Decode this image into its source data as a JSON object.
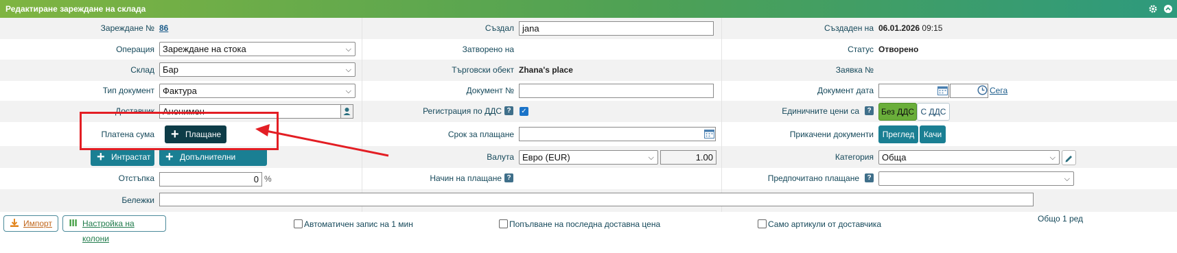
{
  "window": {
    "title": "Редактиране зареждане на склада",
    "icons": [
      "gear-icon",
      "collapse-icon"
    ]
  },
  "fields": {
    "load_no": {
      "label": "Зареждане №",
      "value": "86"
    },
    "created_by": {
      "label": "Създал",
      "value": "jana"
    },
    "created_on": {
      "label": "Създаден на",
      "date": "06.01.2026",
      "time": "09:15"
    },
    "operation": {
      "label": "Операция",
      "value": "Зареждане на стока"
    },
    "closed_on": {
      "label": "Затворено на",
      "value": ""
    },
    "status": {
      "label": "Статус",
      "value": "Отворено"
    },
    "warehouse": {
      "label": "Склад",
      "value": "Бар"
    },
    "outlet": {
      "label": "Търговски обект",
      "value": "Zhana's place"
    },
    "request_no": {
      "label": "Заявка №",
      "value": ""
    },
    "doc_type": {
      "label": "Тип документ",
      "value": "Фактура"
    },
    "doc_no": {
      "label": "Документ №",
      "value": ""
    },
    "doc_date": {
      "label": "Документ дата",
      "value": "",
      "now_link": "Сега"
    },
    "supplier": {
      "label": "Доставчик",
      "value": "Анонимен"
    },
    "vat_reg": {
      "label": "Регистрация по ДДС",
      "help": "?",
      "checked": true
    },
    "unit_prices": {
      "label": "Единичните цени са",
      "option_without_vat": "Без ДДС",
      "option_with_vat": "С ДДС",
      "selected": "Без ДДС"
    },
    "paid_sum": {
      "label": "Платена сума",
      "button": "Плащане"
    },
    "due_date": {
      "label": "Срок за плащане",
      "value": ""
    },
    "attachments": {
      "label": "Прикачени документи",
      "view": "Преглед",
      "upload": "Качи"
    },
    "intrastat": {
      "button": "Интрастат"
    },
    "extra_costs": {
      "button": "Допълнителни разходи"
    },
    "currency": {
      "label": "Валута",
      "value": "Евро (EUR)",
      "rate": "1.00"
    },
    "category": {
      "label": "Категория",
      "value": "Обща"
    },
    "discount": {
      "label": "Отстъпка",
      "value": "0",
      "unit": "%"
    },
    "payment_method": {
      "label": "Начин на плащане",
      "help": "?"
    },
    "preferred_payment": {
      "label": "Предпочитано плащане",
      "help": "?",
      "value": ""
    },
    "notes": {
      "label": "Бележки",
      "value": ""
    }
  },
  "bottom": {
    "import": "Импорт",
    "columns": "Настройка на колони",
    "autosave": "Автоматичен запис на 1 мин",
    "last_price": "Попълване на последна доставна цена",
    "supplier_items": "Само артикули от доставчика",
    "total_label": "Общо 1 ред"
  },
  "annotation": {
    "color": "#e31e24"
  }
}
